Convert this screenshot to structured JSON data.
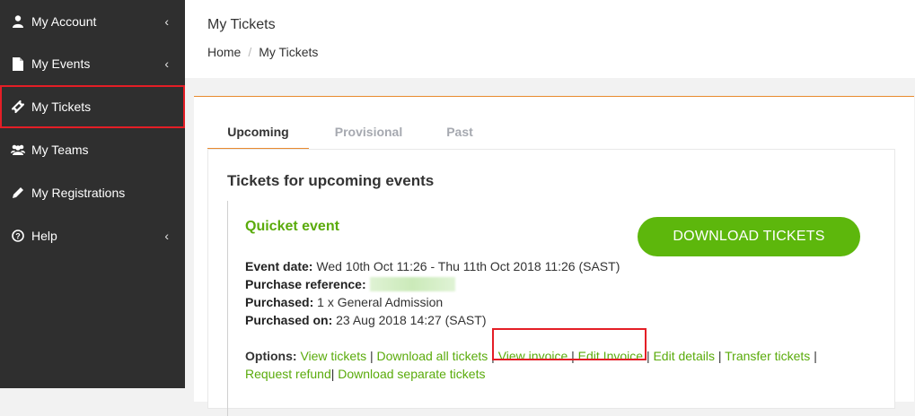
{
  "sidebar": {
    "items": [
      {
        "label": "My Account",
        "icon": "user-icon",
        "has_chevron": true
      },
      {
        "label": "My Events",
        "icon": "file-icon",
        "has_chevron": true
      },
      {
        "label": "My Tickets",
        "icon": "ticket-icon",
        "has_chevron": false,
        "highlighted": true
      },
      {
        "label": "My Teams",
        "icon": "users-icon",
        "has_chevron": false
      },
      {
        "label": "My Registrations",
        "icon": "pencil-icon",
        "has_chevron": false
      },
      {
        "label": "Help",
        "icon": "help-circle-icon",
        "has_chevron": true
      }
    ],
    "chevron": "‹"
  },
  "header": {
    "title": "My Tickets",
    "breadcrumb": {
      "home": "Home",
      "separator": "/",
      "current": "My Tickets"
    }
  },
  "tabs": [
    {
      "label": "Upcoming",
      "active": true
    },
    {
      "label": "Provisional",
      "active": false
    },
    {
      "label": "Past",
      "active": false
    }
  ],
  "section_title": "Tickets for upcoming events",
  "event": {
    "name": "Quicket event",
    "download_button": "DOWNLOAD TICKETS",
    "details": {
      "event_date_label": "Event date:",
      "event_date_value": "Wed 10th Oct 11:26 - Thu 11th Oct 2018 11:26 (SAST)",
      "purchase_ref_label": "Purchase reference:",
      "purchased_label": "Purchased:",
      "purchased_value": "1 x General Admission",
      "purchased_on_label": "Purchased on:",
      "purchased_on_value": "23 Aug 2018 14:27 (SAST)"
    },
    "options": {
      "label": "Options:",
      "view_tickets": "View tickets",
      "download_all": "Download all tickets",
      "view_invoice": "View invoice",
      "edit_invoice": "Edit Invoice",
      "edit_details": "Edit details",
      "transfer_tickets": "Transfer tickets",
      "request_refund": "Request refund",
      "download_separate": "Download separate tickets",
      "separator": "|"
    }
  },
  "colors": {
    "sidebar_bg": "#2f2f2f",
    "accent_orange": "#e88a2e",
    "brand_green": "#5db70c",
    "link_green": "#5aab0b",
    "highlight_red": "#e41e26"
  }
}
